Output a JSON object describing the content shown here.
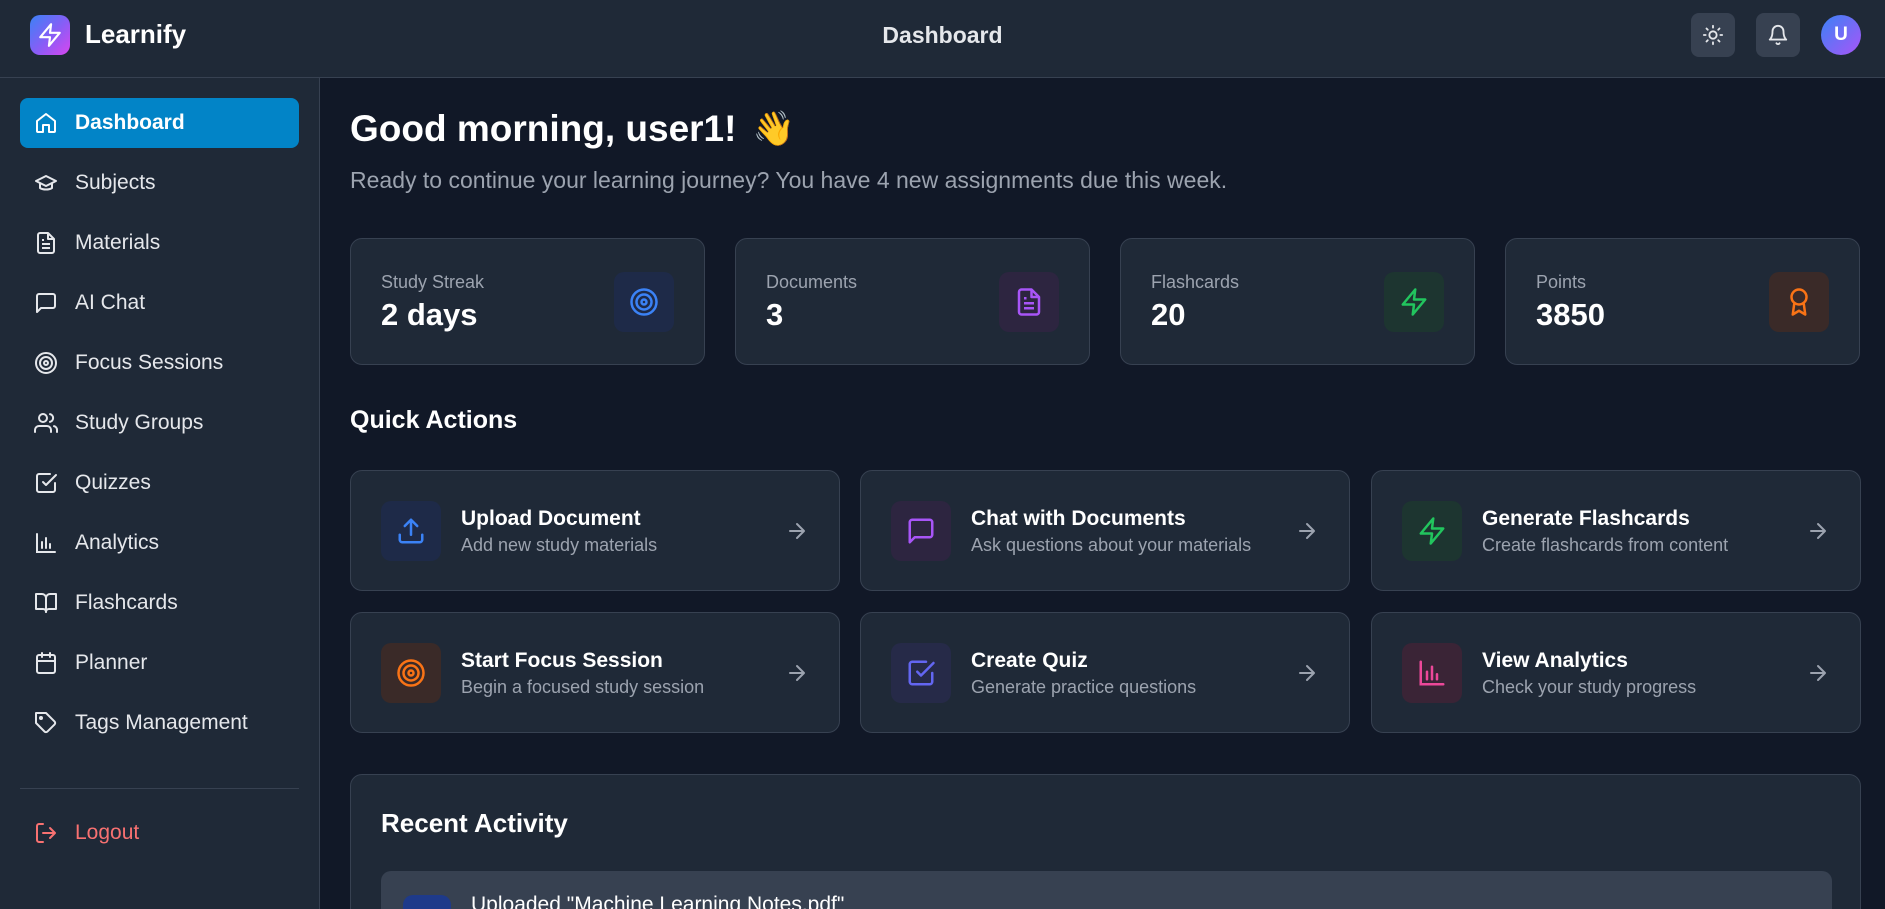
{
  "app": {
    "name": "Learnify",
    "page_title": "Dashboard"
  },
  "header": {
    "theme_toggle_icon": "sun-icon",
    "notifications_icon": "bell-icon",
    "avatar_initial": "U"
  },
  "sidebar": {
    "items": [
      {
        "label": "Dashboard",
        "icon": "home-icon",
        "active": true
      },
      {
        "label": "Subjects",
        "icon": "graduation-cap-icon"
      },
      {
        "label": "Materials",
        "icon": "file-text-icon"
      },
      {
        "label": "AI Chat",
        "icon": "message-square-icon"
      },
      {
        "label": "Focus Sessions",
        "icon": "target-icon"
      },
      {
        "label": "Study Groups",
        "icon": "users-icon"
      },
      {
        "label": "Quizzes",
        "icon": "check-square-icon"
      },
      {
        "label": "Analytics",
        "icon": "bar-chart-icon"
      },
      {
        "label": "Flashcards",
        "icon": "book-open-icon"
      },
      {
        "label": "Planner",
        "icon": "calendar-icon"
      },
      {
        "label": "Tags Management",
        "icon": "tag-icon"
      }
    ],
    "logout_label": "Logout"
  },
  "main": {
    "greeting": "Good morning, user1!",
    "greeting_emoji": "👋",
    "subtitle": "Ready to continue your learning journey? You have 4 new assignments due this week.",
    "stats": [
      {
        "label": "Study Streak",
        "value": "2 days",
        "icon": "target-icon",
        "color": "#3b82f6"
      },
      {
        "label": "Documents",
        "value": "3",
        "icon": "file-text-icon",
        "color": "#a855f7"
      },
      {
        "label": "Flashcards",
        "value": "20",
        "icon": "zap-icon",
        "color": "#22c55e"
      },
      {
        "label": "Points",
        "value": "3850",
        "icon": "award-icon",
        "color": "#f97316"
      }
    ],
    "quick_actions_title": "Quick Actions",
    "quick_actions": [
      {
        "title": "Upload Document",
        "desc": "Add new study materials",
        "icon": "upload-icon",
        "color": "#3b82f6"
      },
      {
        "title": "Chat with Documents",
        "desc": "Ask questions about your materials",
        "icon": "message-square-icon",
        "color": "#a855f7"
      },
      {
        "title": "Generate Flashcards",
        "desc": "Create flashcards from content",
        "icon": "zap-icon",
        "color": "#22c55e"
      },
      {
        "title": "Start Focus Session",
        "desc": "Begin a focused study session",
        "icon": "target-icon",
        "color": "#f97316"
      },
      {
        "title": "Create Quiz",
        "desc": "Generate practice questions",
        "icon": "check-square-icon",
        "color": "#6366f1"
      },
      {
        "title": "View Analytics",
        "desc": "Check your study progress",
        "icon": "bar-chart-icon",
        "color": "#ec4899"
      }
    ],
    "recent_activity_title": "Recent Activity",
    "recent_activity": [
      {
        "text": "Uploaded \"Machine Learning Notes.pdf\"",
        "icon": "upload-icon"
      }
    ]
  }
}
